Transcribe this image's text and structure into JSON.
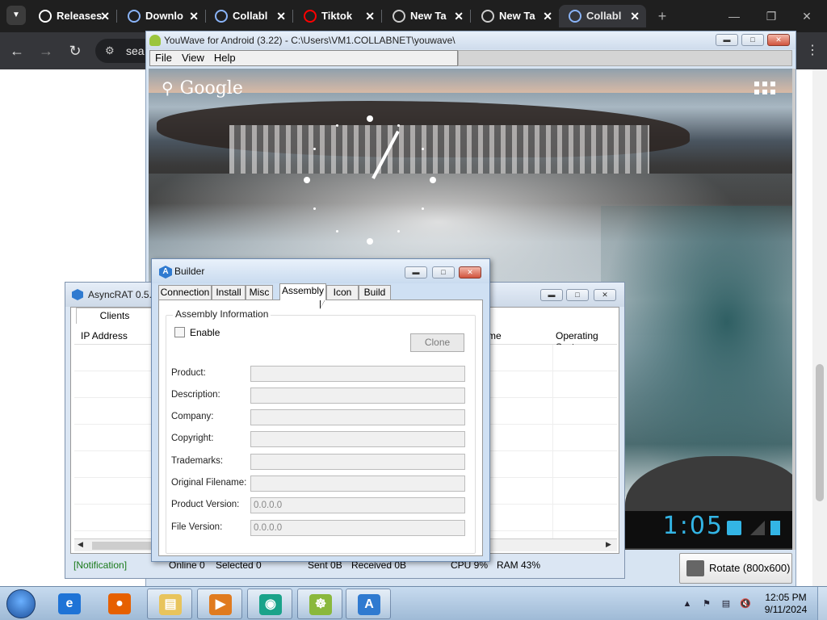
{
  "browser": {
    "tabs": [
      {
        "label": "Releases",
        "icon": "github-icon",
        "color": "#ffffff"
      },
      {
        "label": "Downlo",
        "icon": "download-icon",
        "color": "#8ab4f8"
      },
      {
        "label": "Collabl",
        "icon": "search-icon",
        "color": "#8ab4f8"
      },
      {
        "label": "Tiktok",
        "icon": "youtube-icon",
        "color": "#ff0000"
      },
      {
        "label": "New Ta",
        "icon": "globe-icon",
        "color": "#cccccc"
      },
      {
        "label": "New Ta",
        "icon": "globe-icon",
        "color": "#cccccc"
      },
      {
        "label": "Collabl",
        "icon": "search-icon",
        "color": "#8ab4f8"
      }
    ],
    "address_partial": "sea"
  },
  "youwave": {
    "title": "YouWave for Android (3.22) - C:\\Users\\VM1.COLLABNET\\youwave\\",
    "menu": [
      "File",
      "View",
      "Help"
    ],
    "android": {
      "search_label": "Google",
      "clock": "1:05",
      "rotate_label": "Rotate (800x600)"
    }
  },
  "asyncrat": {
    "title": "AsyncRAT 0.5.8",
    "tab": "Clients",
    "columns": [
      "IP Address",
      "me",
      "Operating Syste"
    ],
    "status": {
      "notification": "[Notification]",
      "online": "Online 0",
      "selected": "Selected 0",
      "sent": "Sent 0B",
      "received": "Received 0B",
      "cpu": "CPU 9%",
      "ram": "RAM 43%"
    }
  },
  "builder": {
    "title": "Builder",
    "tabs": [
      "Connection",
      "Install",
      "Misc",
      "Assembly",
      "Icon",
      "Build"
    ],
    "active_tab": "Assembly",
    "group_title": "Assembly Information",
    "enable_label": "Enable",
    "enable_checked": false,
    "clone_label": "Clone",
    "fields": [
      {
        "label": "Product:",
        "value": ""
      },
      {
        "label": "Description:",
        "value": ""
      },
      {
        "label": "Company:",
        "value": ""
      },
      {
        "label": "Copyright:",
        "value": ""
      },
      {
        "label": "Trademarks:",
        "value": ""
      },
      {
        "label": "Original Filename:",
        "value": ""
      },
      {
        "label": "Product Version:",
        "value": "0.0.0.0"
      },
      {
        "label": "File Version:",
        "value": "0.0.0.0"
      }
    ]
  },
  "taskbar": {
    "items": [
      {
        "name": "internet-explorer-icon",
        "color": "#1e73d6",
        "glyph": "e"
      },
      {
        "name": "firefox-icon",
        "color": "#e66000",
        "glyph": "●"
      },
      {
        "name": "file-explorer-icon",
        "color": "#e8c45c",
        "glyph": "▤"
      },
      {
        "name": "media-player-icon",
        "color": "#e07b1f",
        "glyph": "▶"
      },
      {
        "name": "app-icon",
        "color": "#1aa38a",
        "glyph": "◉"
      },
      {
        "name": "android-icon",
        "color": "#8ab83c",
        "glyph": "☸"
      },
      {
        "name": "asyncrat-icon",
        "color": "#2f7ad0",
        "glyph": "A"
      }
    ],
    "time": "12:05 PM",
    "date": "9/11/2024"
  }
}
